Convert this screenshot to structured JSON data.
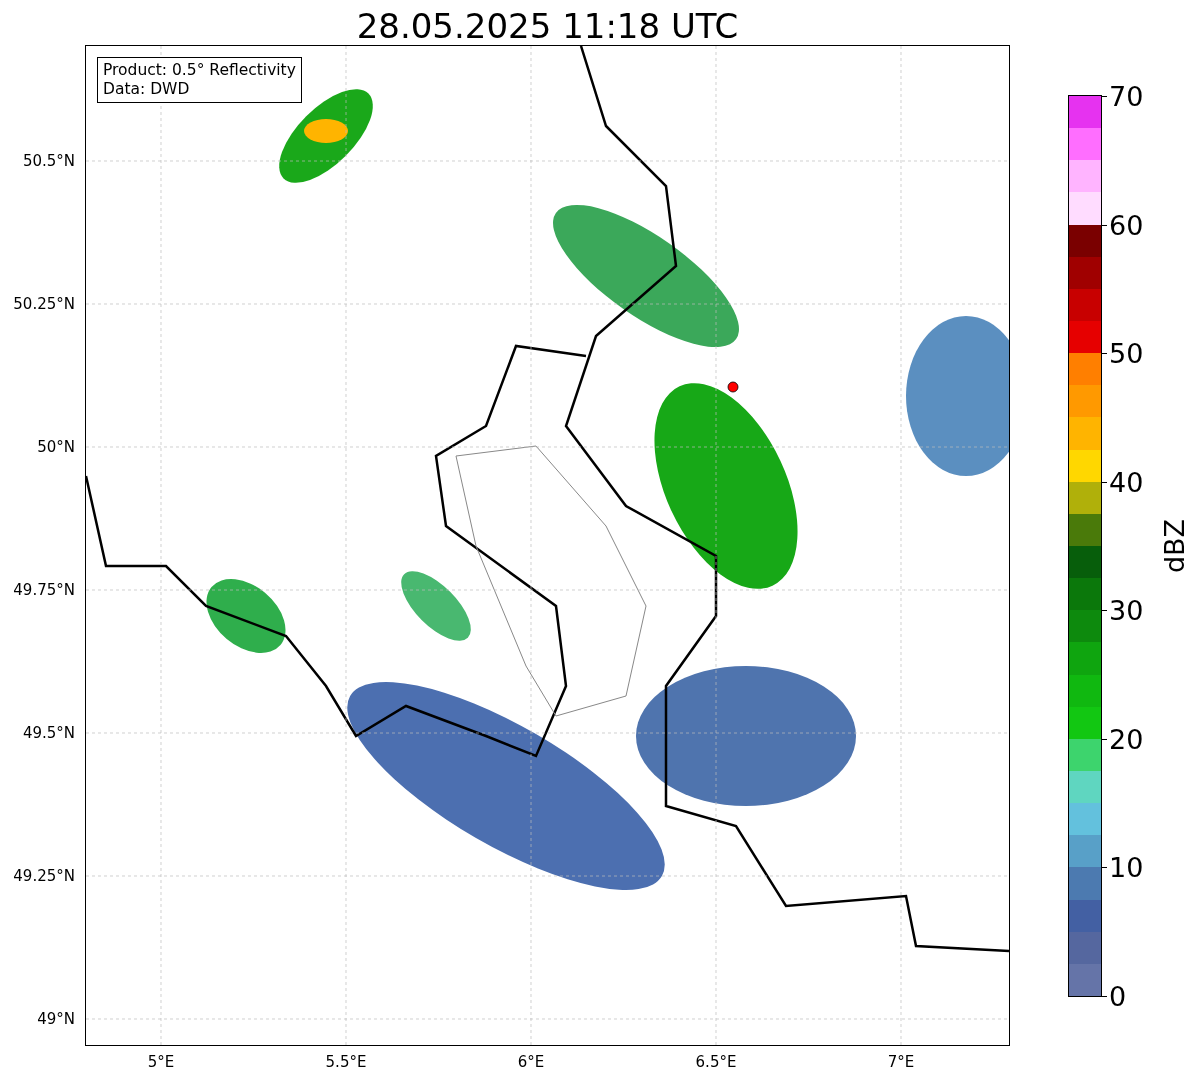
{
  "title": "28.05.2025 11:18 UTC",
  "annotation": [
    "Product: 0.5° Reflectivity",
    "Data: DWD"
  ],
  "y_ticks": [
    "50.5°N",
    "50.25°N",
    "50°N",
    "49.75°N",
    "49.5°N",
    "49.25°N",
    "49°N"
  ],
  "x_ticks": [
    "5°E",
    "5.5°E",
    "6°E",
    "6.5°E",
    "7°E"
  ],
  "colorbar": {
    "label": "dBZ",
    "ticks": [
      "70",
      "60",
      "50",
      "40",
      "30",
      "20",
      "10",
      "0"
    ],
    "bins": [
      {
        "color": "#6574a8"
      },
      {
        "color": "#55679f"
      },
      {
        "color": "#4360a3"
      },
      {
        "color": "#4c7ab0"
      },
      {
        "color": "#58a0c8"
      },
      {
        "color": "#63c1dd"
      },
      {
        "color": "#5fd6c0"
      },
      {
        "color": "#3dd46d"
      },
      {
        "color": "#12c712"
      },
      {
        "color": "#10b810"
      },
      {
        "color": "#0fa50f"
      },
      {
        "color": "#0d8a0d"
      },
      {
        "color": "#0b780b"
      },
      {
        "color": "#075e0b"
      },
      {
        "color": "#4a7a0a"
      },
      {
        "color": "#b0b00a"
      },
      {
        "color": "#ffd700"
      },
      {
        "color": "#ffb400"
      },
      {
        "color": "#ff9900"
      },
      {
        "color": "#ff7f00"
      },
      {
        "color": "#e60000"
      },
      {
        "color": "#c80000"
      },
      {
        "color": "#a00000"
      },
      {
        "color": "#7a0000"
      },
      {
        "color": "#ffdcff"
      },
      {
        "color": "#ffb4ff"
      },
      {
        "color": "#ff6eff"
      },
      {
        "color": "#e632f0"
      }
    ]
  }
}
